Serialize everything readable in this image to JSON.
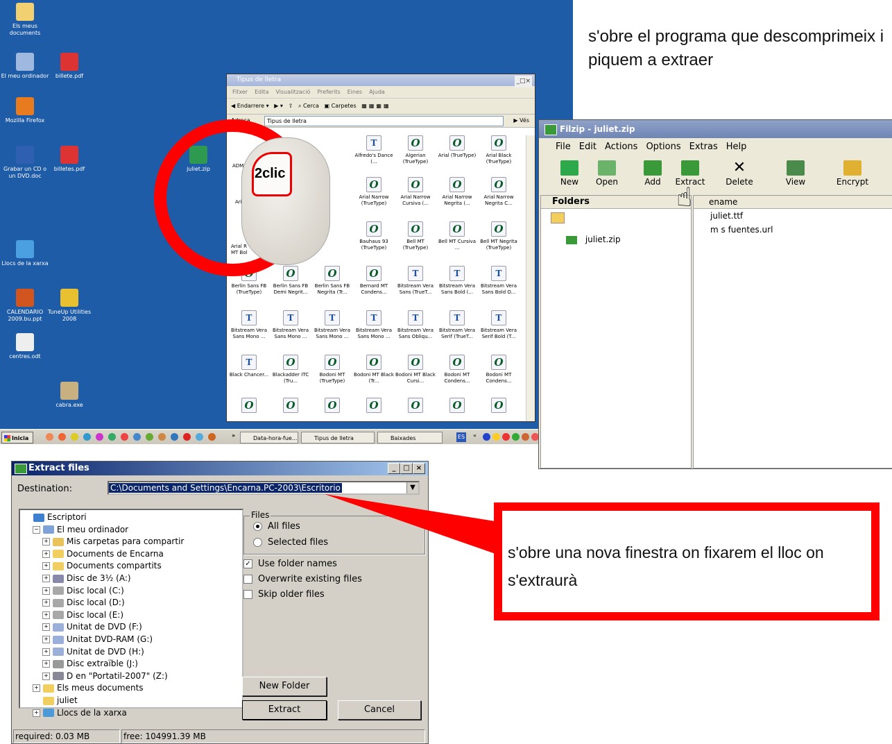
{
  "desktop": {
    "icons": [
      {
        "label": "Els meus documents",
        "icon": "my-documents-icon"
      },
      {
        "label": "El meu ordinador",
        "icon": "computer-icon"
      },
      {
        "label": "billete.pdf",
        "icon": "pdf-icon"
      },
      {
        "label": "Mozilla Firefox",
        "icon": "firefox-icon"
      },
      {
        "label": "Grabar un CD o un DVD.doc",
        "icon": "word-doc-icon"
      },
      {
        "label": "billetes.pdf",
        "icon": "pdf-icon"
      },
      {
        "label": "juliet.zip",
        "icon": "zip-icon"
      },
      {
        "label": "Llocs de la xarxa",
        "icon": "network-icon"
      },
      {
        "label": "CALENDARIO 2009.bu.ppt",
        "icon": "ppt-icon"
      },
      {
        "label": "TuneUp Utilities 2008",
        "icon": "tuneup-icon"
      },
      {
        "label": "centres.odt",
        "icon": "odt-icon"
      },
      {
        "label": "cabra.exe",
        "icon": "goat-icon"
      }
    ],
    "mouse_label": "2clic"
  },
  "taskbar": {
    "start": "Inicia",
    "chevron": "»",
    "buttons": [
      "Data-hora-fue...",
      "Tipus de lletra",
      "Baixades"
    ],
    "lang": "ES",
    "tray_chevron": "«"
  },
  "explorer": {
    "title": "Tipus de lletra",
    "menu": [
      "Fitxer",
      "Edita",
      "Visualització",
      "Preferits",
      "Eines",
      "Ajuda"
    ],
    "toolbar": {
      "back": "Endarrere",
      "search": "Cerca",
      "folders": "Carpetes"
    },
    "address_label": "Adreça",
    "address_value": "Tipus de lletra",
    "go": "Vés",
    "partial_labels": [
      "ADMU",
      "Ari",
      "Arial R MT Bol"
    ],
    "fonts": [
      {
        "name": "Alfredo's Dance (...",
        "type": "T"
      },
      {
        "name": "Algerian (TrueType)",
        "type": "O"
      },
      {
        "name": "Arial (TrueType)",
        "type": "O"
      },
      {
        "name": "Arial Black (TrueType)",
        "type": "O"
      },
      {
        "name": "Arial Narrow (TrueType)",
        "type": "O"
      },
      {
        "name": "Arial Narrow Cursiva (...",
        "type": "O"
      },
      {
        "name": "Arial Narrow Negrita (...",
        "type": "O"
      },
      {
        "name": "Arial Narrow Negrita C...",
        "type": "O"
      },
      {
        "name": "Bauhaus 93 (TrueType)",
        "type": "O"
      },
      {
        "name": "Bell MT (TrueType)",
        "type": "O"
      },
      {
        "name": "Bell MT Cursiva ...",
        "type": "O"
      },
      {
        "name": "Bell MT Negrita (TrueType)",
        "type": "O"
      },
      {
        "name": "Berlin Sans FB (TrueType)",
        "type": "O"
      },
      {
        "name": "Berlin Sans FB Demi Negrit...",
        "type": "O"
      },
      {
        "name": "Berlin Sans FB Negrita (Tr...",
        "type": "O"
      },
      {
        "name": "Bernard MT Condens...",
        "type": "O"
      },
      {
        "name": "Bitstream Vera Sans (TrueT...",
        "type": "T"
      },
      {
        "name": "Bitstream Vera Sans Bold (...",
        "type": "T"
      },
      {
        "name": "Bitstream Vera Sans Bold O...",
        "type": "T"
      },
      {
        "name": "Bitstream Vera Sans Mono ...",
        "type": "T"
      },
      {
        "name": "Bitstream Vera Sans Mono ...",
        "type": "T"
      },
      {
        "name": "Bitstream Vera Sans Mono ...",
        "type": "T"
      },
      {
        "name": "Bitstream Vera Sans Mono ...",
        "type": "T"
      },
      {
        "name": "Bitstream Vera Sans Obliqu...",
        "type": "T"
      },
      {
        "name": "Bitstream Vera Serif (TrueT...",
        "type": "T"
      },
      {
        "name": "Bitstream Vera Serif Bold (T...",
        "type": "T"
      },
      {
        "name": "Black Chancer...",
        "type": "T"
      },
      {
        "name": "Blackadder ITC (Tru...",
        "type": "O"
      },
      {
        "name": "Bodoni MT (TrueType)",
        "type": "O"
      },
      {
        "name": "Bodoni MT Black (Tr...",
        "type": "O"
      },
      {
        "name": "Bodoni MT Black Cursi...",
        "type": "O"
      },
      {
        "name": "Bodoni MT Condens...",
        "type": "O"
      },
      {
        "name": "Bodoni MT Condens...",
        "type": "O"
      }
    ]
  },
  "filzip": {
    "title": "Filzip - juliet.zip",
    "menu": [
      "File",
      "Edit",
      "Actions",
      "Options",
      "Extras",
      "Help"
    ],
    "toolbar": [
      "New",
      "Open",
      "Add",
      "Extract",
      "Delete",
      "View",
      "Encrypt"
    ],
    "folders_header": "Folders",
    "folder_tree": [
      "juliet.zip"
    ],
    "file_header": "ename",
    "files": [
      "juliet.ttf",
      "m s fuentes.url"
    ]
  },
  "extract_dialog": {
    "title": "Extract files",
    "destination_label": "Destination:",
    "destination_value": "C:\\Documents and Settings\\Encarna.PC-2003\\Escritorio",
    "tree": [
      {
        "label": "Escriptori",
        "indent": 0,
        "pm": "",
        "icon": "desktop-icon"
      },
      {
        "label": "El meu ordinador",
        "indent": 1,
        "pm": "−",
        "icon": "computer-icon"
      },
      {
        "label": "Mis carpetas para compartir",
        "indent": 2,
        "pm": "+",
        "icon": "shared-folder-icon"
      },
      {
        "label": "Documents de Encarna",
        "indent": 2,
        "pm": "+",
        "icon": "folder-icon"
      },
      {
        "label": "Documents compartits",
        "indent": 2,
        "pm": "+",
        "icon": "folder-icon"
      },
      {
        "label": "Disc de 3½ (A:)",
        "indent": 2,
        "pm": "+",
        "icon": "floppy-icon"
      },
      {
        "label": "Disc local (C:)",
        "indent": 2,
        "pm": "+",
        "icon": "drive-icon"
      },
      {
        "label": "Disc local (D:)",
        "indent": 2,
        "pm": "+",
        "icon": "drive-icon"
      },
      {
        "label": "Disc local (E:)",
        "indent": 2,
        "pm": "+",
        "icon": "drive-icon"
      },
      {
        "label": "Unitat de DVD (F:)",
        "indent": 2,
        "pm": "+",
        "icon": "dvd-icon"
      },
      {
        "label": "Unitat DVD-RAM (G:)",
        "indent": 2,
        "pm": "+",
        "icon": "dvd-icon"
      },
      {
        "label": "Unitat de DVD (H:)",
        "indent": 2,
        "pm": "+",
        "icon": "dvd-icon"
      },
      {
        "label": "Disc extraïble (J:)",
        "indent": 2,
        "pm": "+",
        "icon": "removable-drive-icon"
      },
      {
        "label": "D en \"Portatil-2007\" (Z:)",
        "indent": 2,
        "pm": "+",
        "icon": "network-drive-icon"
      },
      {
        "label": "Els meus documents",
        "indent": 1,
        "pm": "+",
        "icon": "my-documents-icon"
      },
      {
        "label": "juliet",
        "indent": 1,
        "pm": "",
        "icon": "folder-icon"
      },
      {
        "label": "Llocs de la xarxa",
        "indent": 1,
        "pm": "+",
        "icon": "network-icon"
      }
    ],
    "files_group": "Files",
    "radio_all": "All files",
    "radio_selected": "Selected files",
    "use_folder_names": "Use folder names",
    "overwrite": "Overwrite existing files",
    "skip_older": "Skip older files",
    "new_folder": "New Folder",
    "extract": "Extract",
    "cancel": "Cancel",
    "status_required": "required: 0.03 MB",
    "status_free": "free: 104991.39 MB"
  },
  "annotations": {
    "top_note": "s'obre el programa que descomprimeix i piquem a extraer",
    "callout_note": "s'obre una nova finestra on fixarem el lloc on s'extraurà",
    "highlight_color": "#ff0000"
  },
  "colors": {
    "desktop_bg": "#1f5ca8",
    "dialog_title": "#0a246a",
    "annotation": "#ff0000"
  }
}
